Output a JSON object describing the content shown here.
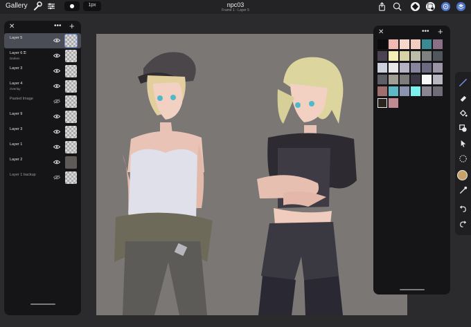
{
  "topbar": {
    "gallery_label": "Gallery",
    "brush_size": "1px",
    "document_title": "npc03",
    "document_subtitle": "Frame 1 - Layer 5"
  },
  "layers_panel": {
    "layers": [
      {
        "name": "Layer 5",
        "blend": "",
        "visible": true,
        "active": true,
        "locked": false,
        "dim": false
      },
      {
        "name": "Layer 6",
        "blend": "Darken",
        "visible": true,
        "active": false,
        "locked": true,
        "dim": false
      },
      {
        "name": "Layer 3",
        "blend": "",
        "visible": true,
        "active": false,
        "locked": false,
        "dim": false
      },
      {
        "name": "Layer 4",
        "blend": "Overlay",
        "visible": true,
        "active": false,
        "locked": false,
        "dim": false
      },
      {
        "name": "Pasted Image",
        "blend": "",
        "visible": false,
        "active": false,
        "locked": false,
        "dim": true
      },
      {
        "name": "Layer 9",
        "blend": "",
        "visible": true,
        "active": false,
        "locked": false,
        "dim": false
      },
      {
        "name": "Layer 3",
        "blend": "",
        "visible": true,
        "active": false,
        "locked": false,
        "dim": false
      },
      {
        "name": "Layer 1",
        "blend": "",
        "visible": true,
        "active": false,
        "locked": false,
        "dim": false
      },
      {
        "name": "Layer 2",
        "blend": "",
        "visible": true,
        "active": false,
        "locked": false,
        "dim": false
      },
      {
        "name": "Layer 1 backup",
        "blend": "",
        "visible": false,
        "active": false,
        "locked": false,
        "dim": true
      }
    ]
  },
  "palette": {
    "swatches": [
      "#0c0c0e",
      "#f4b8b3",
      "#f7d6cb",
      "#f2cdbf",
      "#3a8a93",
      "#8a6f86",
      "#4b4351",
      "#f4efb6",
      "#d8d3a6",
      "#bdbca8",
      "#7d8180",
      "#51565d",
      "#cdd0dd",
      "#e8e7e7",
      "#b5b3c4",
      "#88869f",
      "#6b6a80",
      "#9a94a5",
      "#5e5e66",
      "#a09e95",
      "#7e7c7a",
      "#3a3842",
      "#f8f8fa",
      "#b7b5c0",
      "#a06e6c",
      "#5eb9c6",
      "#8a93b0",
      "#7cf1ed",
      "#8a8590",
      "#6f6b77",
      "#2b241f",
      "#c08a92"
    ]
  },
  "colors": {
    "accent": "#6d8fd6",
    "current_color": "#c9a26a"
  }
}
